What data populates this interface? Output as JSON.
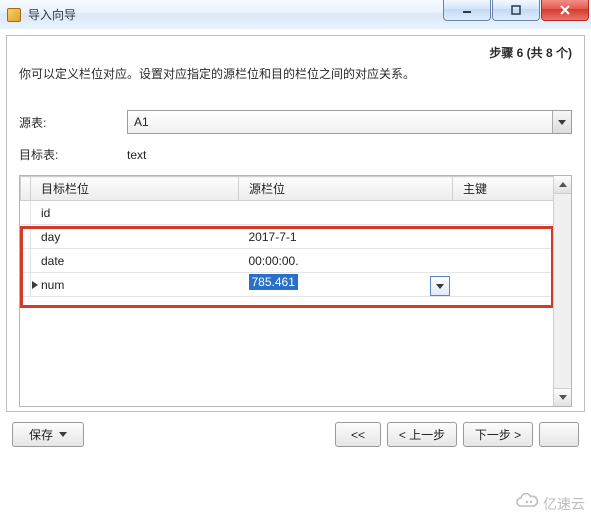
{
  "titlebar": {
    "title": "导入向导"
  },
  "step": {
    "label": "步骤 6 (共 8 个)"
  },
  "description": "你可以定义栏位对应。设置对应指定的源栏位和目的栏位之间的对应关系。",
  "form": {
    "source_table_label": "源表:",
    "source_table_value": "A1",
    "target_table_label": "目标表:",
    "target_table_value": "text"
  },
  "table": {
    "headers": {
      "target": "目标栏位",
      "source": "源栏位",
      "pk": "主键"
    },
    "rows": [
      {
        "target": "id",
        "source": "",
        "active": false
      },
      {
        "target": "day",
        "source": "2017-7-1",
        "active": false
      },
      {
        "target": "date",
        "source": "00:00:00.",
        "active": false
      },
      {
        "target": "num",
        "source": "785.461",
        "active": true
      }
    ]
  },
  "buttons": {
    "save": "保存",
    "first": "<<",
    "prev": "< 上一步",
    "next": "下一步 >",
    "last_visible_text": ""
  },
  "watermark": "亿速云"
}
